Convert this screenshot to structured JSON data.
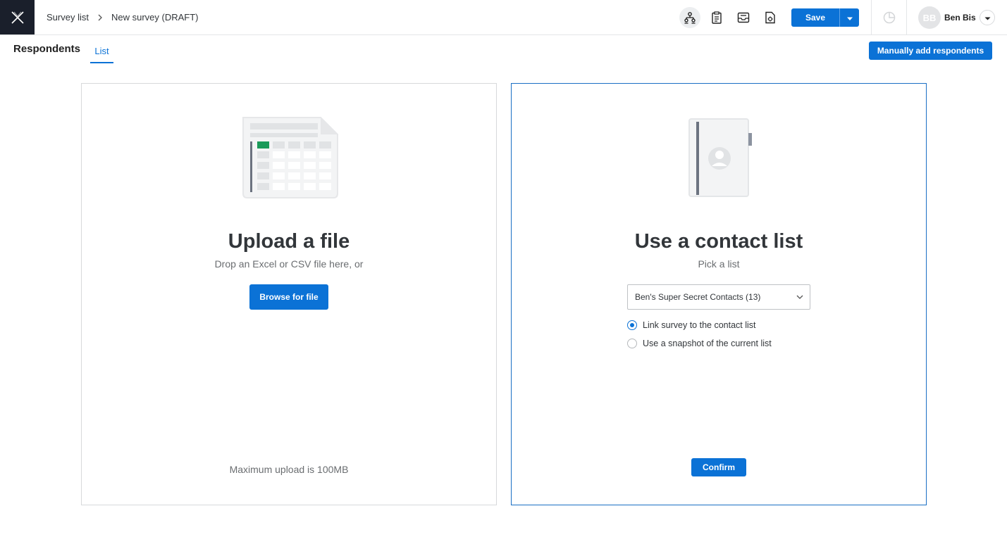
{
  "header": {
    "logo_icon": "x-logo-icon",
    "breadcrumbs": [
      "Survey list",
      "New survey (DRAFT)"
    ],
    "toolbar_icons": [
      "org-chart-icon",
      "clipboard-icon",
      "inbox-icon",
      "file-settings-icon"
    ],
    "save_label": "Save",
    "user": {
      "initials": "BB",
      "name": "Ben Bis"
    }
  },
  "subheader": {
    "title": "Respondents",
    "tab_label": "List",
    "manual_add_label": "Manually add respondents"
  },
  "upload_card": {
    "title": "Upload a file",
    "subtitle": "Drop an Excel or CSV file here, or",
    "browse_label": "Browse for file",
    "max_upload": "Maximum upload is 100MB"
  },
  "contact_card": {
    "title": "Use a contact list",
    "subtitle": "Pick a list",
    "selected_list": "Ben's Super Secret Contacts (13)",
    "options": [
      {
        "label": "Link survey to the contact list",
        "checked": true
      },
      {
        "label": "Use a snapshot of the current list",
        "checked": false
      }
    ],
    "confirm_label": "Confirm"
  },
  "colors": {
    "primary": "#0b72d6",
    "logo_bg": "#1a1f2b",
    "text": "#32363a"
  }
}
